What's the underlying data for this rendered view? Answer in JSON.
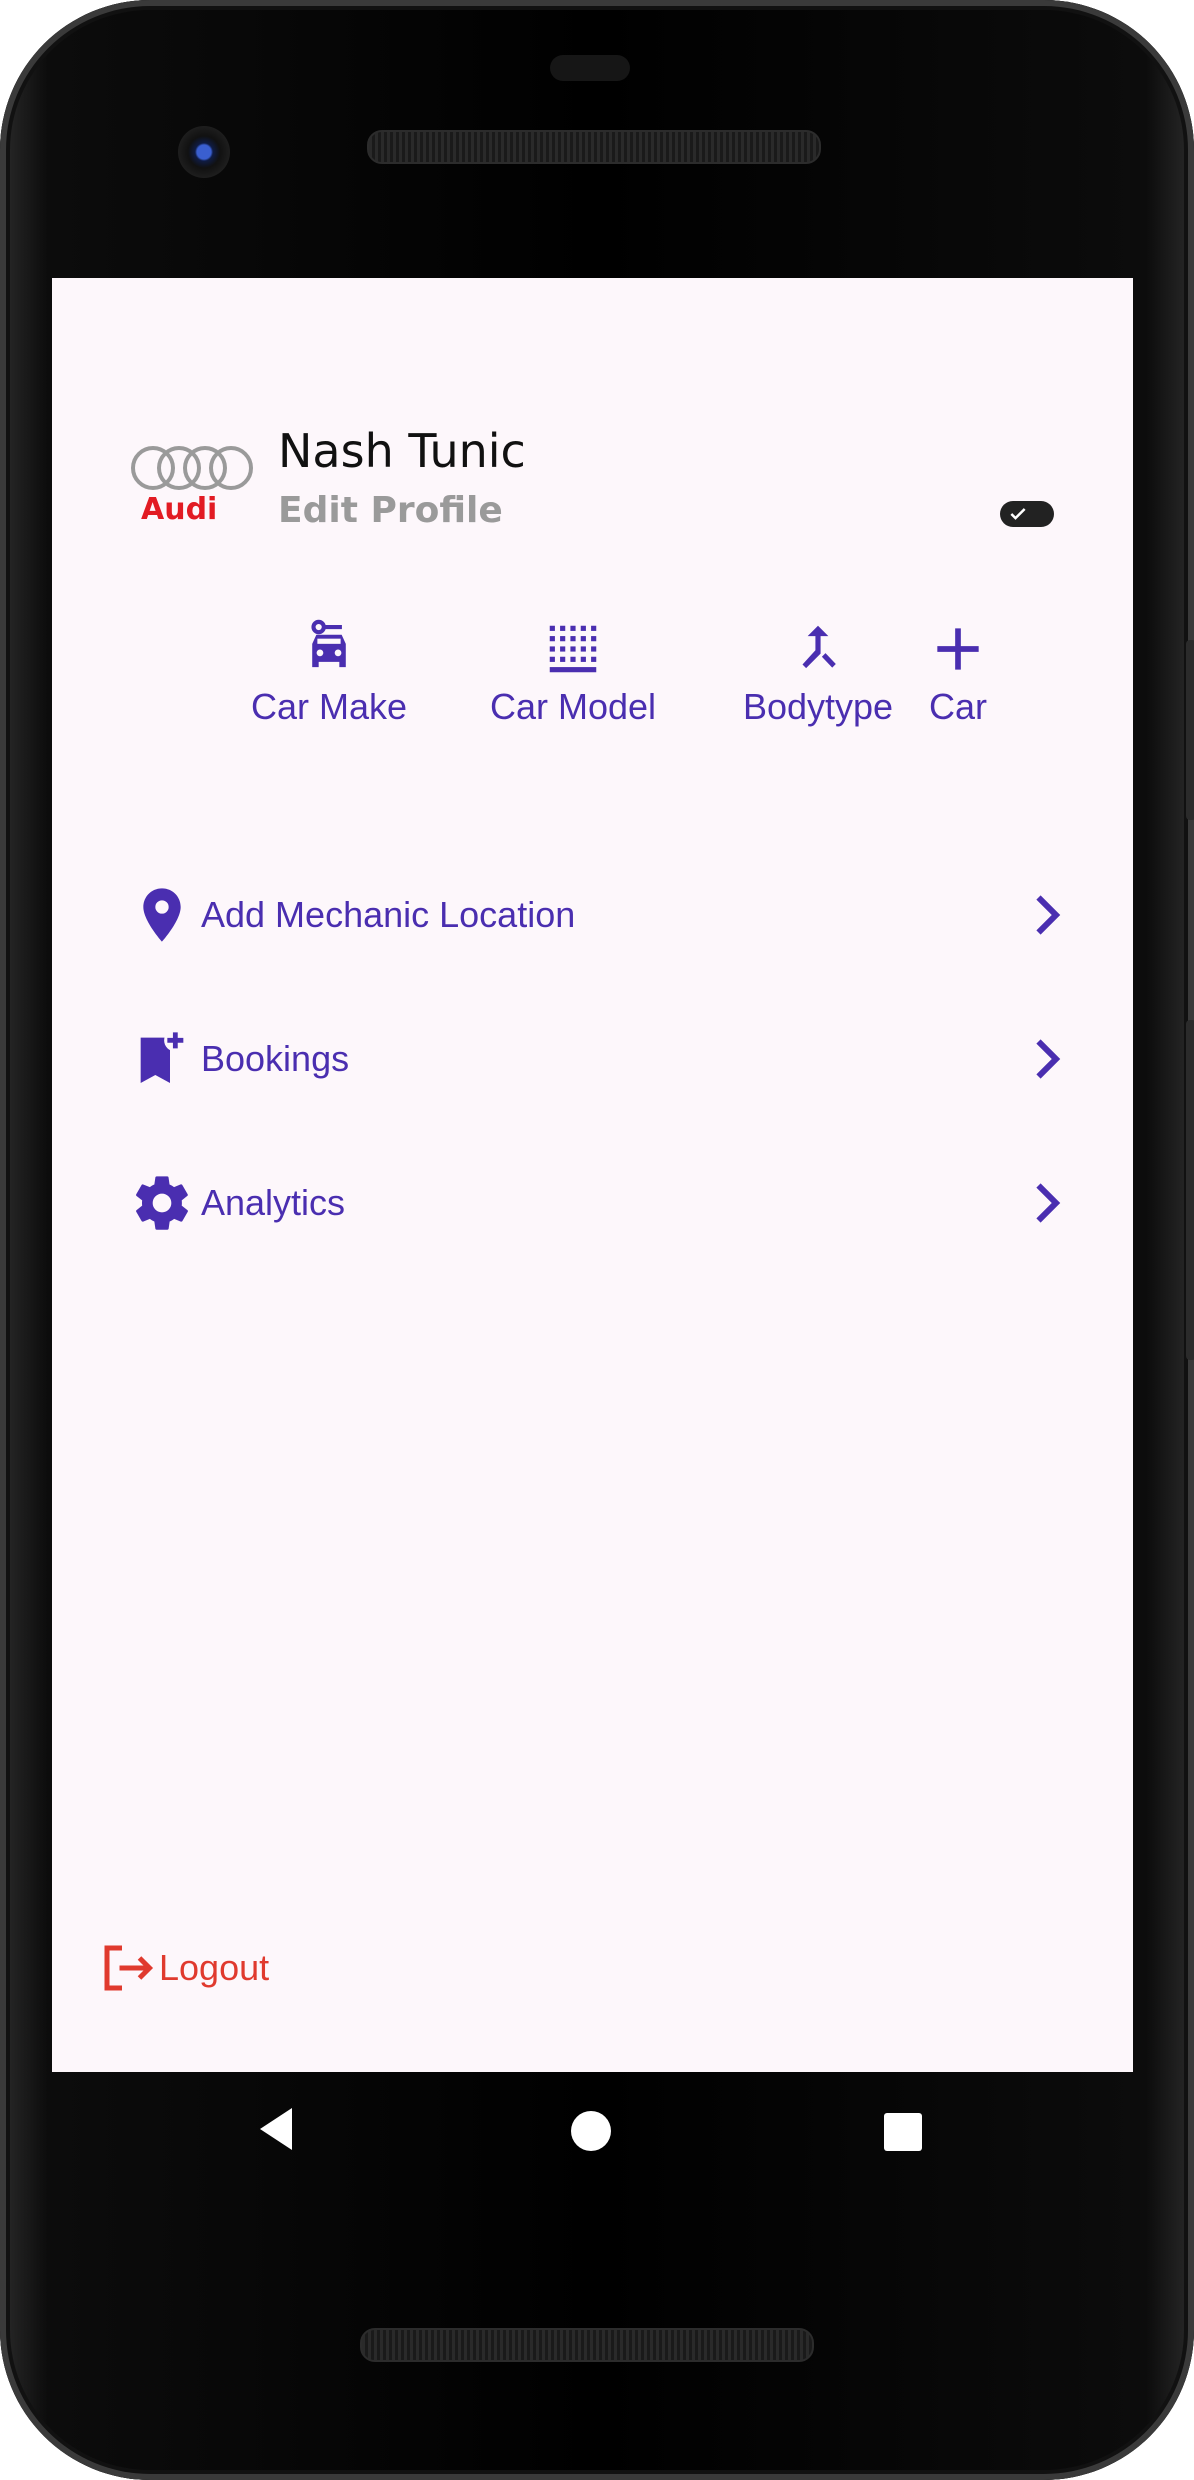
{
  "profile": {
    "avatar_brand_text": "Audi",
    "name": "Nash Tunic",
    "edit_label": "Edit Profile",
    "theme_toggle_on": true
  },
  "actions": [
    {
      "label": "Car Make",
      "icon": "car-repair-icon"
    },
    {
      "label": "Car Model",
      "icon": "grid-icon"
    },
    {
      "label": "Bodytype",
      "icon": "merge-icon"
    },
    {
      "label": "Car",
      "icon": "plus-icon"
    }
  ],
  "menu": [
    {
      "label": "Add Mechanic Location",
      "icon": "location-pin-icon"
    },
    {
      "label": "Bookings",
      "icon": "bookmark-add-icon"
    },
    {
      "label": "Analytics",
      "icon": "gear-icon"
    }
  ],
  "logout": {
    "label": "Logout",
    "icon": "logout-icon"
  },
  "colors": {
    "accent": "#4a2eb0",
    "logout": "#e03a2e",
    "background": "#fdf7fb",
    "muted": "#9a9a9a"
  },
  "system_nav": {
    "back_icon": "back-triangle-icon",
    "home_icon": "home-circle-icon",
    "recents_icon": "recents-square-icon"
  }
}
